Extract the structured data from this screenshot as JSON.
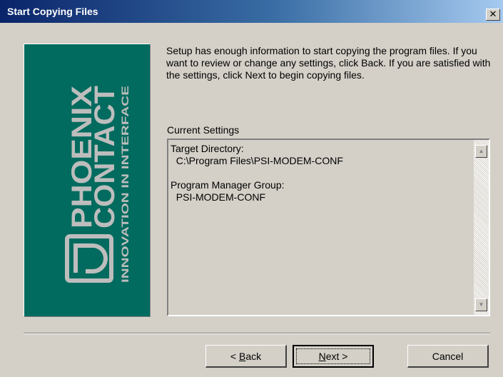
{
  "window": {
    "title": "Start Copying Files",
    "close_glyph": "✕"
  },
  "banner": {
    "brand_line1": "PHOENIX",
    "brand_line2": "CONTACT",
    "tagline": "INNOVATION IN INTERFACE",
    "background": "#006b5e"
  },
  "intro": {
    "text": "Setup has enough information to start copying the program files. If you want to review or change any settings, click Back. If you are satisfied with the settings, click Next to begin copying files."
  },
  "settings": {
    "label": "Current Settings",
    "content": "Target Directory:\n  C:\\Program Files\\PSI-MODEM-CONF\n\nProgram Manager Group:\n  PSI-MODEM-CONF"
  },
  "scrollbar": {
    "up_glyph": "▲",
    "down_glyph": "▼"
  },
  "buttons": {
    "back_prefix": "< ",
    "back_accel": "B",
    "back_rest": "ack",
    "next_accel": "N",
    "next_rest": "ext >",
    "cancel": "Cancel"
  }
}
